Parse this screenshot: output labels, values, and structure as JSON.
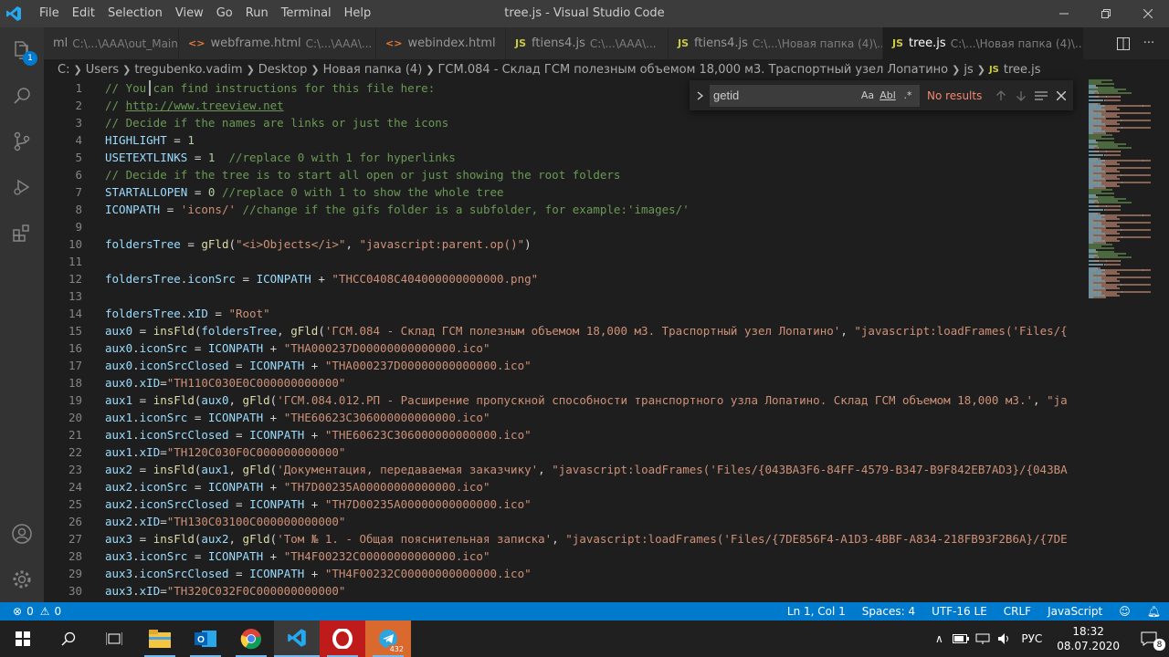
{
  "window": {
    "title": "tree.js - Visual Studio Code",
    "menu": [
      "File",
      "Edit",
      "Selection",
      "View",
      "Go",
      "Run",
      "Terminal",
      "Help"
    ]
  },
  "activity_bar": {
    "explorer_badge": "1"
  },
  "tabs": [
    {
      "icon": "",
      "name": "ml",
      "desc": "C:\\...\\AAA\\out_Main",
      "active": false
    },
    {
      "icon": "<>",
      "name": "webframe.html",
      "desc": "C:\\...\\AAA\\...",
      "active": false
    },
    {
      "icon": "<>",
      "name": "webindex.html",
      "desc": "",
      "active": false
    },
    {
      "icon": "JS",
      "name": "ftiens4.js",
      "desc": "C:\\...\\AAA\\...",
      "active": false
    },
    {
      "icon": "JS",
      "name": "ftiens4.js",
      "desc": "C:\\...\\Новая папка (4)\\...",
      "active": false
    },
    {
      "icon": "JS",
      "name": "tree.js",
      "desc": "C:\\...\\Новая папка (4)\\...",
      "active": true
    }
  ],
  "breadcrumb": [
    "C:",
    "Users",
    "tregubenko.vadim",
    "Desktop",
    "Новая папка (4)",
    "ГСМ.084 - Склад ГСМ полезным объемом 18,000 м3. Траспортный узел Лопатино",
    "js",
    "tree.js"
  ],
  "breadcrumb_file_icon": "JS",
  "find": {
    "value": "getid",
    "case_label": "Aa",
    "word_label": "Abl",
    "regex_label": ".*",
    "result": "No results"
  },
  "code": [
    [
      [
        "c",
        "// You can find instructions for this file here:"
      ]
    ],
    [
      [
        "c",
        "// "
      ],
      [
        "u",
        "http://www.treeview.net"
      ]
    ],
    [
      [
        "c",
        "// Decide if the names are links or just the icons"
      ]
    ],
    [
      [
        "v",
        "HIGHLIGHT"
      ],
      [
        "d",
        " = "
      ],
      [
        "n",
        "1"
      ]
    ],
    [
      [
        "v",
        "USETEXTLINKS"
      ],
      [
        "d",
        " = "
      ],
      [
        "n",
        "1"
      ],
      [
        "d",
        "  "
      ],
      [
        "c",
        "//replace 0 with 1 for hyperlinks"
      ]
    ],
    [
      [
        "c",
        "// Decide if the tree is to start all open or just showing the root folders"
      ]
    ],
    [
      [
        "v",
        "STARTALLOPEN"
      ],
      [
        "d",
        " = "
      ],
      [
        "n",
        "0"
      ],
      [
        "d",
        " "
      ],
      [
        "c",
        "//replace 0 with 1 to show the whole tree"
      ]
    ],
    [
      [
        "v",
        "ICONPATH"
      ],
      [
        "d",
        " = "
      ],
      [
        "s",
        "'icons/'"
      ],
      [
        "d",
        " "
      ],
      [
        "c",
        "//change if the gifs folder is a subfolder, for example:'images/'"
      ]
    ],
    [],
    [
      [
        "v",
        "foldersTree"
      ],
      [
        "d",
        " = "
      ],
      [
        "f",
        "gFld"
      ],
      [
        "d",
        "("
      ],
      [
        "s",
        "\"<i>Objects</i>\""
      ],
      [
        "d",
        ", "
      ],
      [
        "s",
        "\"javascript:parent.op()\""
      ],
      [
        "d",
        ")"
      ]
    ],
    [],
    [
      [
        "v",
        "foldersTree"
      ],
      [
        "d",
        "."
      ],
      [
        "v",
        "iconSrc"
      ],
      [
        "d",
        " = "
      ],
      [
        "v",
        "ICONPATH"
      ],
      [
        "d",
        " + "
      ],
      [
        "s",
        "\"THCC0408C404000000000000.png\""
      ]
    ],
    [],
    [
      [
        "v",
        "foldersTree"
      ],
      [
        "d",
        "."
      ],
      [
        "v",
        "xID"
      ],
      [
        "d",
        " = "
      ],
      [
        "s",
        "\"Root\""
      ]
    ],
    [
      [
        "v",
        "aux0"
      ],
      [
        "d",
        " = "
      ],
      [
        "f",
        "insFld"
      ],
      [
        "d",
        "("
      ],
      [
        "v",
        "foldersTree"
      ],
      [
        "d",
        ", "
      ],
      [
        "f",
        "gFld"
      ],
      [
        "d",
        "("
      ],
      [
        "s",
        "'ГСМ.084 - Склад ГСМ полезным объемом 18,000 м3. Траспортный узел Лопатино'"
      ],
      [
        "d",
        ", "
      ],
      [
        "s",
        "\"javascript:loadFrames('Files/{"
      ]
    ],
    [
      [
        "v",
        "aux0"
      ],
      [
        "d",
        "."
      ],
      [
        "v",
        "iconSrc"
      ],
      [
        "d",
        " = "
      ],
      [
        "v",
        "ICONPATH"
      ],
      [
        "d",
        " + "
      ],
      [
        "s",
        "\"THA000237D00000000000000.ico\""
      ]
    ],
    [
      [
        "v",
        "aux0"
      ],
      [
        "d",
        "."
      ],
      [
        "v",
        "iconSrcClosed"
      ],
      [
        "d",
        " = "
      ],
      [
        "v",
        "ICONPATH"
      ],
      [
        "d",
        " + "
      ],
      [
        "s",
        "\"THA000237D00000000000000.ico\""
      ]
    ],
    [
      [
        "v",
        "aux0"
      ],
      [
        "d",
        "."
      ],
      [
        "v",
        "xID"
      ],
      [
        "d",
        "="
      ],
      [
        "s",
        "\"TH110C030E0C000000000000\""
      ]
    ],
    [
      [
        "v",
        "aux1"
      ],
      [
        "d",
        " = "
      ],
      [
        "f",
        "insFld"
      ],
      [
        "d",
        "("
      ],
      [
        "v",
        "aux0"
      ],
      [
        "d",
        ", "
      ],
      [
        "f",
        "gFld"
      ],
      [
        "d",
        "("
      ],
      [
        "s",
        "'ГСМ.084.012.РП - Расширение пропускной способности транспортного узла Лопатино. Склад ГСМ объемом 18,000 м3.'"
      ],
      [
        "d",
        ", "
      ],
      [
        "s",
        "\"ja"
      ]
    ],
    [
      [
        "v",
        "aux1"
      ],
      [
        "d",
        "."
      ],
      [
        "v",
        "iconSrc"
      ],
      [
        "d",
        " = "
      ],
      [
        "v",
        "ICONPATH"
      ],
      [
        "d",
        " + "
      ],
      [
        "s",
        "\"THE60623C306000000000000.ico\""
      ]
    ],
    [
      [
        "v",
        "aux1"
      ],
      [
        "d",
        "."
      ],
      [
        "v",
        "iconSrcClosed"
      ],
      [
        "d",
        " = "
      ],
      [
        "v",
        "ICONPATH"
      ],
      [
        "d",
        " + "
      ],
      [
        "s",
        "\"THE60623C306000000000000.ico\""
      ]
    ],
    [
      [
        "v",
        "aux1"
      ],
      [
        "d",
        "."
      ],
      [
        "v",
        "xID"
      ],
      [
        "d",
        "="
      ],
      [
        "s",
        "\"TH120C030F0C000000000000\""
      ]
    ],
    [
      [
        "v",
        "aux2"
      ],
      [
        "d",
        " = "
      ],
      [
        "f",
        "insFld"
      ],
      [
        "d",
        "("
      ],
      [
        "v",
        "aux1"
      ],
      [
        "d",
        ", "
      ],
      [
        "f",
        "gFld"
      ],
      [
        "d",
        "("
      ],
      [
        "s",
        "'Документация, передаваемая заказчику'"
      ],
      [
        "d",
        ", "
      ],
      [
        "s",
        "\"javascript:loadFrames('Files/{043BA3F6-84FF-4579-B347-B9F842EB7AD3}/{043BA"
      ]
    ],
    [
      [
        "v",
        "aux2"
      ],
      [
        "d",
        "."
      ],
      [
        "v",
        "iconSrc"
      ],
      [
        "d",
        " = "
      ],
      [
        "v",
        "ICONPATH"
      ],
      [
        "d",
        " + "
      ],
      [
        "s",
        "\"TH7D00235A00000000000000.ico\""
      ]
    ],
    [
      [
        "v",
        "aux2"
      ],
      [
        "d",
        "."
      ],
      [
        "v",
        "iconSrcClosed"
      ],
      [
        "d",
        " = "
      ],
      [
        "v",
        "ICONPATH"
      ],
      [
        "d",
        " + "
      ],
      [
        "s",
        "\"TH7D00235A00000000000000.ico\""
      ]
    ],
    [
      [
        "v",
        "aux2"
      ],
      [
        "d",
        "."
      ],
      [
        "v",
        "xID"
      ],
      [
        "d",
        "="
      ],
      [
        "s",
        "\"TH130C03100C000000000000\""
      ]
    ],
    [
      [
        "v",
        "aux3"
      ],
      [
        "d",
        " = "
      ],
      [
        "f",
        "insFld"
      ],
      [
        "d",
        "("
      ],
      [
        "v",
        "aux2"
      ],
      [
        "d",
        ", "
      ],
      [
        "f",
        "gFld"
      ],
      [
        "d",
        "("
      ],
      [
        "s",
        "'Том № 1. - Общая пояснительная записка'"
      ],
      [
        "d",
        ", "
      ],
      [
        "s",
        "\"javascript:loadFrames('Files/{7DE856F4-A1D3-4BBF-A834-218FB93F2B6A}/{7DE"
      ]
    ],
    [
      [
        "v",
        "aux3"
      ],
      [
        "d",
        "."
      ],
      [
        "v",
        "iconSrc"
      ],
      [
        "d",
        " = "
      ],
      [
        "v",
        "ICONPATH"
      ],
      [
        "d",
        " + "
      ],
      [
        "s",
        "\"TH4F00232C00000000000000.ico\""
      ]
    ],
    [
      [
        "v",
        "aux3"
      ],
      [
        "d",
        "."
      ],
      [
        "v",
        "iconSrcClosed"
      ],
      [
        "d",
        " = "
      ],
      [
        "v",
        "ICONPATH"
      ],
      [
        "d",
        " + "
      ],
      [
        "s",
        "\"TH4F00232C00000000000000.ico\""
      ]
    ],
    [
      [
        "v",
        "aux3"
      ],
      [
        "d",
        "."
      ],
      [
        "v",
        "xID"
      ],
      [
        "d",
        "="
      ],
      [
        "s",
        "\"TH320C032F0C000000000000\""
      ]
    ]
  ],
  "token_colors": {
    "c": "#6a9955",
    "u": "#6a9955",
    "v": "#9cdcfe",
    "f": "#dcdcaa",
    "s": "#ce9178",
    "n": "#b5cea8",
    "d": "#d4d4d4"
  },
  "status": {
    "errors": "0",
    "warnings": "0",
    "position": "Ln 1, Col 1",
    "spaces": "Spaces: 4",
    "encoding": "UTF-16 LE",
    "eol": "CRLF",
    "language": "JavaScript"
  },
  "taskbar": {
    "telegram_badge": "432",
    "language": "РУС",
    "time": "18:32",
    "date": "08.07.2020",
    "notifications": "8"
  },
  "colors": {
    "accent": "#007acc",
    "titlebar": "#3c3c3c",
    "editor_bg": "#1e1e1e"
  }
}
